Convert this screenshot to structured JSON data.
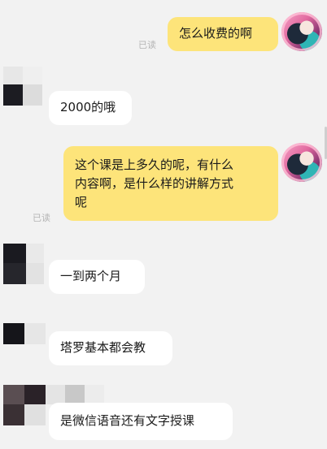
{
  "messages": [
    {
      "id": "m1",
      "direction": "out",
      "text": "怎么收费的啊",
      "status": "已读"
    },
    {
      "id": "m2",
      "direction": "in",
      "text": "2000的哦"
    },
    {
      "id": "m3",
      "direction": "out",
      "lines": [
        "这个课是上多久的呢，有什么",
        "内容啊，是什么样的讲解方式",
        "呢"
      ],
      "status": "已读"
    },
    {
      "id": "m4",
      "direction": "in",
      "text": "一到两个月"
    },
    {
      "id": "m5",
      "direction": "in",
      "text": "塔罗基本都会教"
    },
    {
      "id": "m6",
      "direction": "in",
      "text": "是微信语音还有文字授课"
    }
  ],
  "colors": {
    "background": "#f2f2f2",
    "outgoing_bubble": "#fde47a",
    "incoming_bubble": "#ffffff",
    "read_status": "#b5b5b5"
  }
}
